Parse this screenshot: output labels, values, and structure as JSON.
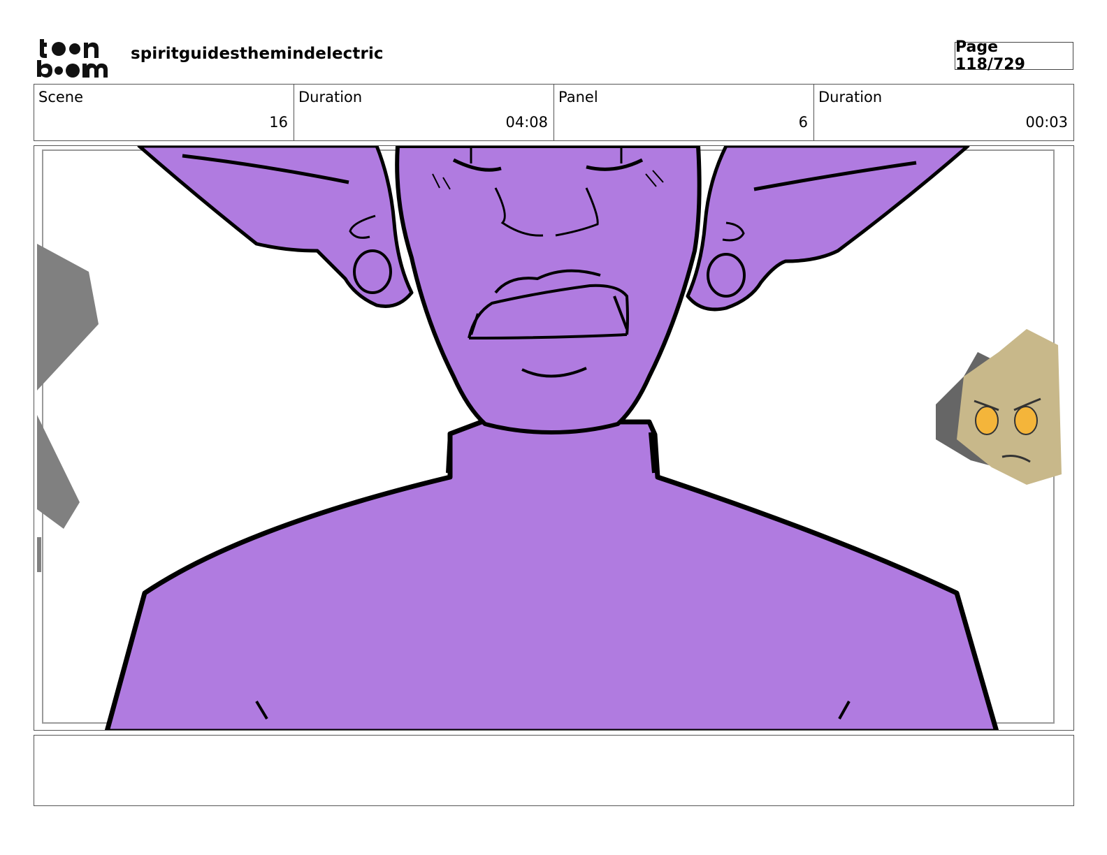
{
  "header": {
    "project_title": "spiritguidesthemindelectric",
    "page_label": "Page 118/729",
    "logo": {
      "text_line1": "toon",
      "text_line2": "boom"
    }
  },
  "info": {
    "scene_label": "Scene",
    "scene_value": "16",
    "scene_duration_label": "Duration",
    "scene_duration_value": "04:08",
    "panel_label": "Panel",
    "panel_value": "6",
    "panel_duration_label": "Duration",
    "panel_duration_value": "00:03"
  },
  "colors": {
    "skin_purple": "#b07be0",
    "outline": "#000000",
    "shadow_gray": "#808080",
    "tan_character": "#c8b88a",
    "glow_yellow": "#f4b53a"
  },
  "notes": {
    "text": ""
  }
}
